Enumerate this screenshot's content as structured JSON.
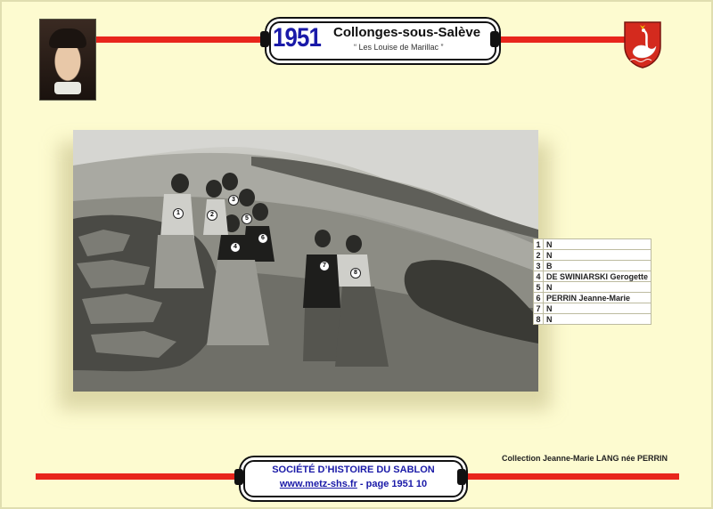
{
  "header": {
    "year": "1951",
    "place": "Collonges-sous-Salève",
    "subtitle": "“ Les Louise de Marillac ”"
  },
  "photo": {
    "markers": [
      "1",
      "2",
      "3",
      "4",
      "5",
      "6",
      "7",
      "8"
    ]
  },
  "people": [
    {
      "num": "1",
      "name": "N"
    },
    {
      "num": "2",
      "name": "N"
    },
    {
      "num": "3",
      "name": "B"
    },
    {
      "num": "4",
      "name": "DE SWINIARSKI Gerogette"
    },
    {
      "num": "5",
      "name": "N"
    },
    {
      "num": "6",
      "name": "PERRIN Jeanne-Marie"
    },
    {
      "num": "7",
      "name": "N"
    },
    {
      "num": "8",
      "name": "N"
    }
  ],
  "collection": "Collection Jeanne-Marie LANG née PERRIN",
  "footer": {
    "society": "SOCIÉTÉ D’HISTOIRE DU SABLON",
    "url": "www.metz-shs.fr",
    "page": " - page 1951 10"
  },
  "colors": {
    "background": "#fdfbd0",
    "accent_red": "#e8251c",
    "title_blue": "#1a1aa8"
  },
  "icons": {
    "portrait": "nun-portrait-image",
    "crest": "swan-coat-of-arms"
  }
}
